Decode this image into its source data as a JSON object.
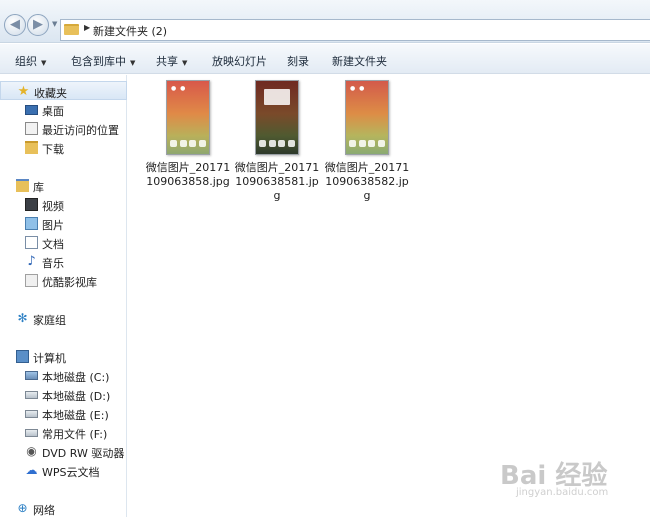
{
  "address_bar": {
    "path": "新建文件夹 (2)"
  },
  "toolbar": {
    "organize": "组织",
    "include_in_library": "包含到库中",
    "share": "共享",
    "slideshow": "放映幻灯片",
    "burn": "刻录",
    "new_folder": "新建文件夹"
  },
  "nav": {
    "favorites": "收藏夹",
    "desktop": "桌面",
    "recent": "最近访问的位置",
    "downloads": "下载",
    "libraries": "库",
    "videos": "视频",
    "pictures": "图片",
    "documents": "文档",
    "music": "音乐",
    "youku": "优酷影视库",
    "homegroup": "家庭组",
    "computer": "计算机",
    "drive_c": "本地磁盘 (C:)",
    "drive_d": "本地磁盘 (D:)",
    "drive_e": "本地磁盘 (E:)",
    "drive_f": "常用文件 (F:)",
    "dvd": "DVD RW 驱动器 (G",
    "wps": "WPS云文档",
    "network": "网络"
  },
  "files": [
    {
      "name": "微信图片_20171109063858.jpg"
    },
    {
      "name": "微信图片_201711090638581.jpg"
    },
    {
      "name": "微信图片_201711090638582.jpg"
    }
  ],
  "watermark": {
    "brand": "Bai 经验",
    "url": "jingyan.baidu.com"
  }
}
